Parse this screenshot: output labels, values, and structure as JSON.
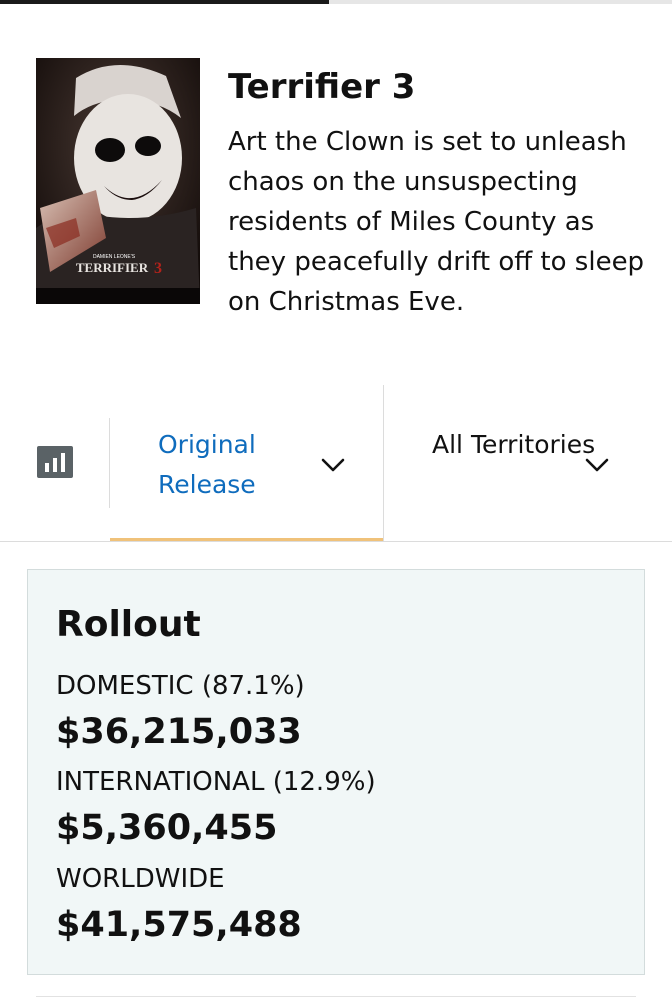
{
  "top_strip": {
    "progress_fraction": 0.49
  },
  "movie": {
    "title": "Terrifier 3",
    "synopsis": "Art the Clown is set to unleash chaos on the unsuspecting residents of Miles County as they peacefully drift off to sleep on Christmas Eve.",
    "poster": {
      "credit_text": "DAMIEN LEONE'S",
      "logo_text": "TERRIFIER"
    }
  },
  "filters": {
    "chart_icon": "bar-chart-icon",
    "release": {
      "label": "Original Release",
      "icon": "chevron-down-icon"
    },
    "territory": {
      "label": "All Territories",
      "icon": "chevron-down-icon"
    }
  },
  "rollout": {
    "title": "Rollout",
    "metrics": [
      {
        "label": "DOMESTIC (87.1%)",
        "value": "$36,215,033"
      },
      {
        "label": "INTERNATIONAL (12.9%)",
        "value": "$5,360,455"
      },
      {
        "label": "WORLDWIDE",
        "value": "$41,575,488"
      }
    ]
  },
  "colors": {
    "link_blue": "#0f6cbd",
    "selected_underline": "#f0c27a",
    "card_background": "#f1f7f7"
  }
}
